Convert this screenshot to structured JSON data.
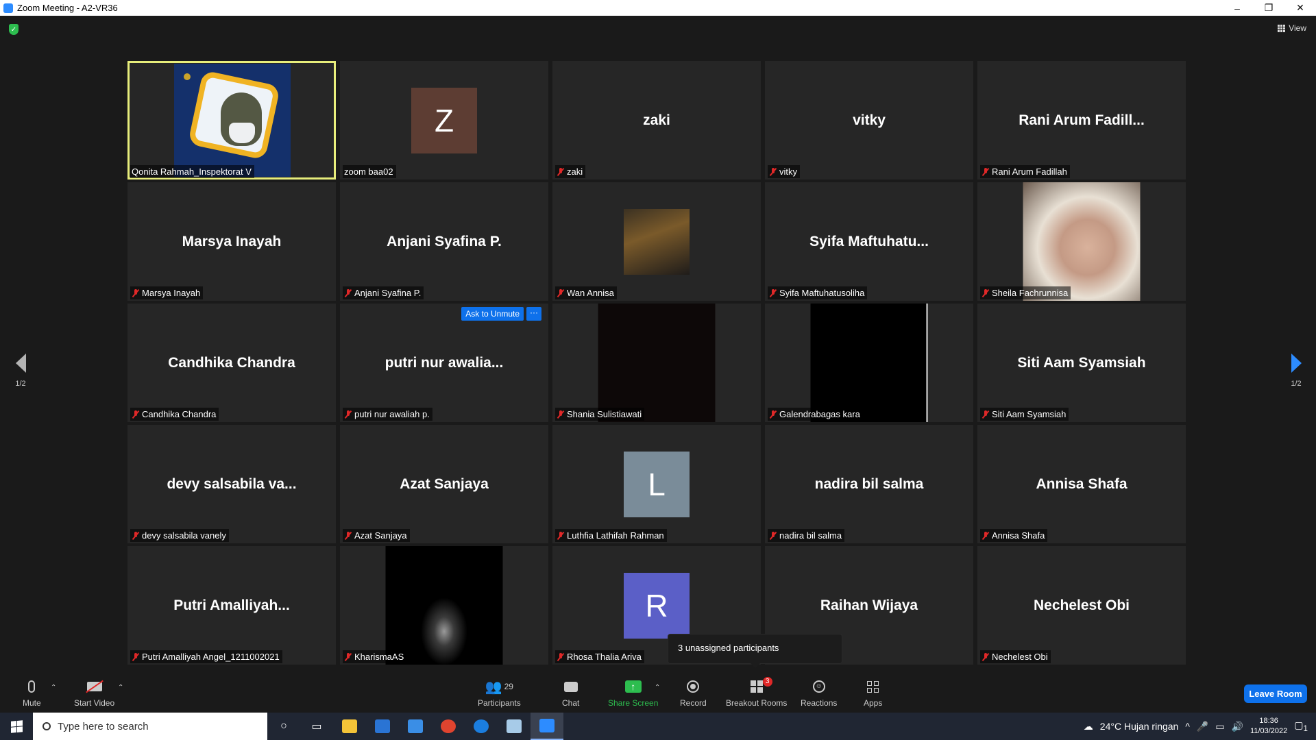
{
  "window": {
    "title": "Zoom Meeting - A2-VR36",
    "controls": [
      "–",
      "❐",
      "✕"
    ]
  },
  "top": {
    "view_label": "View"
  },
  "gallery": {
    "tiles": [
      {
        "label": "Qonita Rahmah_Inspektorat V",
        "display": "",
        "muted": false,
        "active": true,
        "type": "video-qonita"
      },
      {
        "label": "zoom baa02",
        "display": "",
        "muted": false,
        "type": "avatar",
        "initial": "Z",
        "color": "#5d3d33"
      },
      {
        "label": "zaki",
        "display": "zaki",
        "muted": true,
        "type": "name"
      },
      {
        "label": "vitky",
        "display": "vitky",
        "muted": true,
        "type": "name"
      },
      {
        "label": "Rani Arum Fadillah",
        "display": "Rani  Arum  Fadill...",
        "muted": true,
        "type": "name"
      },
      {
        "label": "Marsya Inayah",
        "display": "Marsya Inayah",
        "muted": true,
        "type": "name"
      },
      {
        "label": "Anjani Syafina P.",
        "display": "Anjani Syafina P.",
        "muted": true,
        "type": "name"
      },
      {
        "label": "Wan Annisa",
        "display": "",
        "muted": true,
        "type": "photo-small"
      },
      {
        "label": "Syifa Maftuhatusoliha",
        "display": "Syifa  Maftuhatu...",
        "muted": true,
        "type": "name"
      },
      {
        "label": "Sheila Fachrunnisa",
        "display": "",
        "muted": true,
        "type": "photo-sheila"
      },
      {
        "label": "Candhika Chandra",
        "display": "Candhika Chandra",
        "muted": true,
        "type": "name"
      },
      {
        "label": "putri nur awaliah p.",
        "display": "putri nur awalia...",
        "muted": true,
        "type": "name",
        "ask_unmute": "Ask to Unmute",
        "more": "···"
      },
      {
        "label": "Shania Sulistiawati",
        "display": "",
        "muted": true,
        "type": "video-dark"
      },
      {
        "label": "Galendrabagas kara",
        "display": "",
        "muted": true,
        "type": "video-black"
      },
      {
        "label": "Siti Aam Syamsiah",
        "display": "Siti Aam Syamsiah",
        "muted": true,
        "type": "name"
      },
      {
        "label": "devy salsabila vanely",
        "display": "devy salsabila va...",
        "muted": true,
        "type": "name"
      },
      {
        "label": "Azat Sanjaya",
        "display": "Azat Sanjaya",
        "muted": true,
        "type": "name"
      },
      {
        "label": "Luthfia Lathifah Rahman",
        "display": "",
        "muted": true,
        "type": "avatar",
        "initial": "L",
        "color": "#7a8c99"
      },
      {
        "label": "nadira bil salma",
        "display": "nadira bil salma",
        "muted": true,
        "type": "name"
      },
      {
        "label": "Annisa Shafa",
        "display": "Annisa Shafa",
        "muted": true,
        "type": "name"
      },
      {
        "label": "Putri Amalliyah Angel_1211002021",
        "display": "Putri  Amalliyah...",
        "muted": true,
        "type": "name"
      },
      {
        "label": "KharismaAS",
        "display": "",
        "muted": true,
        "type": "video-bw"
      },
      {
        "label": "Rhosa Thalia Ariva",
        "display": "",
        "muted": true,
        "type": "avatar",
        "initial": "R",
        "color": "#5b5fc7"
      },
      {
        "label": "",
        "display": "Raihan Wijaya",
        "muted": false,
        "type": "name"
      },
      {
        "label": "Nechelest Obi",
        "display": "Nechelest Obi",
        "muted": true,
        "type": "name"
      }
    ]
  },
  "pager": {
    "left_text": "1/2",
    "right_text": "1/2"
  },
  "tooltip": {
    "text": "3 unassigned participants"
  },
  "toolbar": {
    "mute": "Mute",
    "start_video": "Start Video",
    "participants": "Participants",
    "participants_count": "29",
    "chat": "Chat",
    "share_screen": "Share Screen",
    "record": "Record",
    "breakout_rooms": "Breakout Rooms",
    "breakout_badge": "3",
    "reactions": "Reactions",
    "apps": "Apps",
    "leave": "Leave Room"
  },
  "taskbar": {
    "search_placeholder": "Type here to search",
    "weather": "24°C  Hujan ringan",
    "time": "18:36",
    "date": "11/03/2022",
    "notification_count": "1"
  },
  "colors": {
    "accent": "#0e71eb",
    "active_speaker": "#e7ed7b",
    "muted_red": "#e02828",
    "share_green": "#2dbd4f"
  }
}
